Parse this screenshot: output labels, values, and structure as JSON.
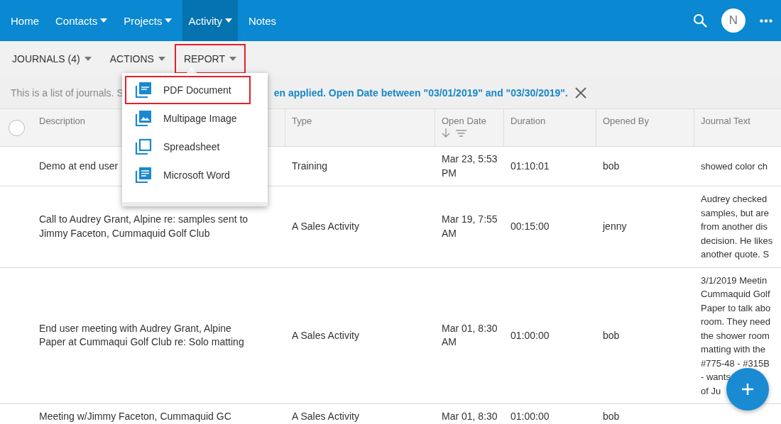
{
  "nav": {
    "items": [
      {
        "label": "Home",
        "dropdown": false,
        "selected": false
      },
      {
        "label": "Contacts",
        "dropdown": true,
        "selected": false
      },
      {
        "label": "Projects",
        "dropdown": true,
        "selected": false
      },
      {
        "label": "Activity",
        "dropdown": true,
        "selected": true
      },
      {
        "label": "Notes",
        "dropdown": false,
        "selected": false
      }
    ],
    "avatar": "N"
  },
  "toolbar": [
    {
      "label": "JOURNALS (4)",
      "highlighted": false
    },
    {
      "label": "ACTIONS",
      "highlighted": false
    },
    {
      "label": "REPORT",
      "highlighted": true
    }
  ],
  "report_menu": [
    {
      "label": "PDF Document",
      "kind": "pdf",
      "highlighted": true
    },
    {
      "label": "Multipage Image",
      "kind": "image",
      "highlighted": false
    },
    {
      "label": "Spreadsheet",
      "kind": "sheet",
      "highlighted": false
    },
    {
      "label": "Microsoft Word",
      "kind": "word",
      "highlighted": false
    }
  ],
  "info": {
    "text": "This is a list of journals. S",
    "filter": "en applied. Open Date between \"03/01/2019\" and \"03/30/2019\"."
  },
  "table": {
    "all_selected": false,
    "columns": [
      {
        "label": "Description",
        "sorted": false
      },
      {
        "label": "Type",
        "sorted": false
      },
      {
        "label": "Open Date",
        "sorted": true
      },
      {
        "label": "Duration",
        "sorted": false
      },
      {
        "label": "Opened By",
        "sorted": false
      },
      {
        "label": "Journal Text",
        "sorted": false
      }
    ],
    "rows": [
      {
        "description": "Demo at end user",
        "type": "Training",
        "open_date": "Mar 23, 5:53 PM",
        "duration": "01:10:01",
        "opened_by": "bob",
        "journal_text": [
          "showed color ch"
        ]
      },
      {
        "description": "Call to Audrey Grant, Alpine re: samples sent to Jimmy Faceton, Cummaquid Golf Club",
        "type": "A Sales Activity",
        "open_date": "Mar 19, 7:55 AM",
        "duration": "00:15:00",
        "opened_by": "jenny",
        "journal_text": [
          "Audrey checked",
          "samples, but are",
          "from another dis",
          "decision. He likes",
          "another quote. S"
        ]
      },
      {
        "description": "End user meeting with Audrey Grant, Alpine Paper at Cummaqui Golf Club re: Solo matting",
        "type": "A Sales Activity",
        "open_date": "Mar 01, 8:30 AM",
        "duration": "01:00:00",
        "opened_by": "bob",
        "journal_text": [
          "3/1/2019 Meetin",
          "Cummaquid Golf",
          "Paper to talk abo",
          "room. They need",
          "the shower room",
          "matting with the",
          "#775-48 - #315B",
          "- wants",
          "of Ju"
        ]
      },
      {
        "description": "Meeting w/Jimmy Faceton, Cummaquid GC",
        "type": "A Sales Activity",
        "open_date": "Mar 01, 8:30",
        "duration": "01:00:00",
        "opened_by": "bob"
      }
    ]
  }
}
